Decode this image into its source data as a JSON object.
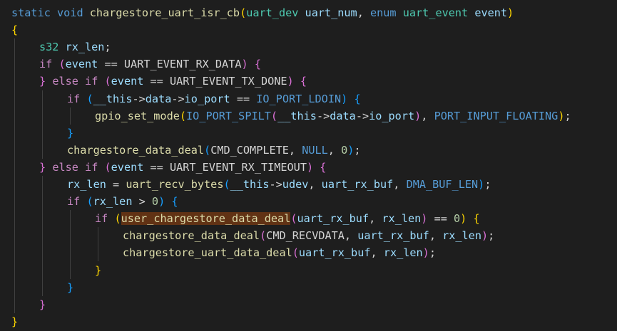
{
  "editor": {
    "background": "#1e1e1e",
    "token_colors": {
      "keyword": "#569cd6",
      "control": "#c586c0",
      "function": "#dcdcaa",
      "type": "#4ec9b0",
      "variable": "#9cdcfe",
      "macro": "#569cd6",
      "number": "#b5cea8",
      "plain": "#d4d4d4",
      "brace_gold": "#ffd700",
      "brace_purple": "#da70d6",
      "brace_blue": "#179fff"
    },
    "highlight_color": "#613214",
    "code_lines": [
      {
        "indent": 0,
        "tokens": [
          {
            "t": "static",
            "k": "keyword"
          },
          {
            "t": " ",
            "k": "plain"
          },
          {
            "t": "void",
            "k": "keyword"
          },
          {
            "t": " ",
            "k": "plain"
          },
          {
            "t": "chargestore_uart_isr_cb",
            "k": "function"
          },
          {
            "t": "(",
            "k": "brace_gold"
          },
          {
            "t": "uart_dev",
            "k": "type"
          },
          {
            "t": " ",
            "k": "plain"
          },
          {
            "t": "uart_num",
            "k": "variable"
          },
          {
            "t": ", ",
            "k": "plain"
          },
          {
            "t": "enum",
            "k": "keyword"
          },
          {
            "t": " ",
            "k": "plain"
          },
          {
            "t": "uart_event",
            "k": "type"
          },
          {
            "t": " ",
            "k": "plain"
          },
          {
            "t": "event",
            "k": "variable"
          },
          {
            "t": ")",
            "k": "brace_gold"
          }
        ]
      },
      {
        "indent": 0,
        "tokens": [
          {
            "t": "{",
            "k": "brace_gold"
          }
        ]
      },
      {
        "indent": 1,
        "tokens": [
          {
            "t": "s32",
            "k": "type"
          },
          {
            "t": " ",
            "k": "plain"
          },
          {
            "t": "rx_len",
            "k": "variable"
          },
          {
            "t": ";",
            "k": "plain"
          }
        ]
      },
      {
        "indent": 1,
        "tokens": [
          {
            "t": "if",
            "k": "control"
          },
          {
            "t": " ",
            "k": "plain"
          },
          {
            "t": "(",
            "k": "brace_purple"
          },
          {
            "t": "event",
            "k": "variable"
          },
          {
            "t": " == ",
            "k": "plain"
          },
          {
            "t": "UART_EVENT_RX_DATA",
            "k": "plain"
          },
          {
            "t": ")",
            "k": "brace_purple"
          },
          {
            "t": " ",
            "k": "plain"
          },
          {
            "t": "{",
            "k": "brace_purple"
          }
        ]
      },
      {
        "indent": 1,
        "tokens": [
          {
            "t": "}",
            "k": "brace_purple"
          },
          {
            "t": " ",
            "k": "plain"
          },
          {
            "t": "else",
            "k": "control"
          },
          {
            "t": " ",
            "k": "plain"
          },
          {
            "t": "if",
            "k": "control"
          },
          {
            "t": " ",
            "k": "plain"
          },
          {
            "t": "(",
            "k": "brace_purple"
          },
          {
            "t": "event",
            "k": "variable"
          },
          {
            "t": " == ",
            "k": "plain"
          },
          {
            "t": "UART_EVENT_TX_DONE",
            "k": "plain"
          },
          {
            "t": ")",
            "k": "brace_purple"
          },
          {
            "t": " ",
            "k": "plain"
          },
          {
            "t": "{",
            "k": "brace_purple"
          }
        ]
      },
      {
        "indent": 2,
        "tokens": [
          {
            "t": "if",
            "k": "control"
          },
          {
            "t": " ",
            "k": "plain"
          },
          {
            "t": "(",
            "k": "brace_blue"
          },
          {
            "t": "__this",
            "k": "variable"
          },
          {
            "t": "->",
            "k": "plain"
          },
          {
            "t": "data",
            "k": "variable"
          },
          {
            "t": "->",
            "k": "plain"
          },
          {
            "t": "io_port",
            "k": "variable"
          },
          {
            "t": " == ",
            "k": "plain"
          },
          {
            "t": "IO_PORT_LDOIN",
            "k": "macro"
          },
          {
            "t": ")",
            "k": "brace_blue"
          },
          {
            "t": " ",
            "k": "plain"
          },
          {
            "t": "{",
            "k": "brace_blue"
          }
        ]
      },
      {
        "indent": 3,
        "tokens": [
          {
            "t": "gpio_set_mode",
            "k": "function"
          },
          {
            "t": "(",
            "k": "brace_gold"
          },
          {
            "t": "IO_PORT_SPILT",
            "k": "macro"
          },
          {
            "t": "(",
            "k": "brace_purple"
          },
          {
            "t": "__this",
            "k": "variable"
          },
          {
            "t": "->",
            "k": "plain"
          },
          {
            "t": "data",
            "k": "variable"
          },
          {
            "t": "->",
            "k": "plain"
          },
          {
            "t": "io_port",
            "k": "variable"
          },
          {
            "t": ")",
            "k": "brace_purple"
          },
          {
            "t": ", ",
            "k": "plain"
          },
          {
            "t": "PORT_INPUT_FLOATING",
            "k": "macro"
          },
          {
            "t": ")",
            "k": "brace_gold"
          },
          {
            "t": ";",
            "k": "plain"
          }
        ]
      },
      {
        "indent": 2,
        "tokens": [
          {
            "t": "}",
            "k": "brace_blue"
          }
        ]
      },
      {
        "indent": 2,
        "tokens": [
          {
            "t": "chargestore_data_deal",
            "k": "function"
          },
          {
            "t": "(",
            "k": "brace_blue"
          },
          {
            "t": "CMD_COMPLETE",
            "k": "plain"
          },
          {
            "t": ", ",
            "k": "plain"
          },
          {
            "t": "NULL",
            "k": "macro"
          },
          {
            "t": ", ",
            "k": "plain"
          },
          {
            "t": "0",
            "k": "number"
          },
          {
            "t": ")",
            "k": "brace_blue"
          },
          {
            "t": ";",
            "k": "plain"
          }
        ]
      },
      {
        "indent": 1,
        "tokens": [
          {
            "t": "}",
            "k": "brace_purple"
          },
          {
            "t": " ",
            "k": "plain"
          },
          {
            "t": "else",
            "k": "control"
          },
          {
            "t": " ",
            "k": "plain"
          },
          {
            "t": "if",
            "k": "control"
          },
          {
            "t": " ",
            "k": "plain"
          },
          {
            "t": "(",
            "k": "brace_purple"
          },
          {
            "t": "event",
            "k": "variable"
          },
          {
            "t": " == ",
            "k": "plain"
          },
          {
            "t": "UART_EVENT_RX_TIMEOUT",
            "k": "plain"
          },
          {
            "t": ")",
            "k": "brace_purple"
          },
          {
            "t": " ",
            "k": "plain"
          },
          {
            "t": "{",
            "k": "brace_purple"
          }
        ]
      },
      {
        "indent": 2,
        "tokens": [
          {
            "t": "rx_len",
            "k": "variable"
          },
          {
            "t": " = ",
            "k": "plain"
          },
          {
            "t": "uart_recv_bytes",
            "k": "function"
          },
          {
            "t": "(",
            "k": "brace_blue"
          },
          {
            "t": "__this",
            "k": "variable"
          },
          {
            "t": "->",
            "k": "plain"
          },
          {
            "t": "udev",
            "k": "variable"
          },
          {
            "t": ", ",
            "k": "plain"
          },
          {
            "t": "uart_rx_buf",
            "k": "variable"
          },
          {
            "t": ", ",
            "k": "plain"
          },
          {
            "t": "DMA_BUF_LEN",
            "k": "macro"
          },
          {
            "t": ")",
            "k": "brace_blue"
          },
          {
            "t": ";",
            "k": "plain"
          }
        ]
      },
      {
        "indent": 2,
        "tokens": [
          {
            "t": "if",
            "k": "control"
          },
          {
            "t": " ",
            "k": "plain"
          },
          {
            "t": "(",
            "k": "brace_blue"
          },
          {
            "t": "rx_len",
            "k": "variable"
          },
          {
            "t": " > ",
            "k": "plain"
          },
          {
            "t": "0",
            "k": "number"
          },
          {
            "t": ")",
            "k": "brace_blue"
          },
          {
            "t": " ",
            "k": "plain"
          },
          {
            "t": "{",
            "k": "brace_blue"
          }
        ]
      },
      {
        "indent": 3,
        "tokens": [
          {
            "t": "if",
            "k": "control"
          },
          {
            "t": " ",
            "k": "plain"
          },
          {
            "t": "(",
            "k": "brace_gold"
          },
          {
            "t": "user_chargestore_data_deal",
            "k": "function",
            "hl": true
          },
          {
            "t": "(",
            "k": "brace_purple"
          },
          {
            "t": "uart_rx_buf",
            "k": "variable"
          },
          {
            "t": ", ",
            "k": "plain"
          },
          {
            "t": "rx_len",
            "k": "variable"
          },
          {
            "t": ")",
            "k": "brace_purple"
          },
          {
            "t": " == ",
            "k": "plain"
          },
          {
            "t": "0",
            "k": "number"
          },
          {
            "t": ")",
            "k": "brace_gold"
          },
          {
            "t": " ",
            "k": "plain"
          },
          {
            "t": "{",
            "k": "brace_gold"
          }
        ]
      },
      {
        "indent": 4,
        "tokens": [
          {
            "t": "chargestore_data_deal",
            "k": "function"
          },
          {
            "t": "(",
            "k": "brace_purple"
          },
          {
            "t": "CMD_RECVDATA",
            "k": "plain"
          },
          {
            "t": ", ",
            "k": "plain"
          },
          {
            "t": "uart_rx_buf",
            "k": "variable"
          },
          {
            "t": ", ",
            "k": "plain"
          },
          {
            "t": "rx_len",
            "k": "variable"
          },
          {
            "t": ")",
            "k": "brace_purple"
          },
          {
            "t": ";",
            "k": "plain"
          }
        ]
      },
      {
        "indent": 4,
        "tokens": [
          {
            "t": "chargestore_uart_data_deal",
            "k": "function"
          },
          {
            "t": "(",
            "k": "brace_purple"
          },
          {
            "t": "uart_rx_buf",
            "k": "variable"
          },
          {
            "t": ", ",
            "k": "plain"
          },
          {
            "t": "rx_len",
            "k": "variable"
          },
          {
            "t": ")",
            "k": "brace_purple"
          },
          {
            "t": ";",
            "k": "plain"
          }
        ]
      },
      {
        "indent": 3,
        "tokens": [
          {
            "t": "}",
            "k": "brace_gold"
          }
        ]
      },
      {
        "indent": 2,
        "tokens": [
          {
            "t": "}",
            "k": "brace_blue"
          }
        ]
      },
      {
        "indent": 1,
        "tokens": [
          {
            "t": "}",
            "k": "brace_purple"
          }
        ]
      },
      {
        "indent": 0,
        "tokens": [
          {
            "t": "}",
            "k": "brace_gold"
          }
        ]
      }
    ]
  }
}
